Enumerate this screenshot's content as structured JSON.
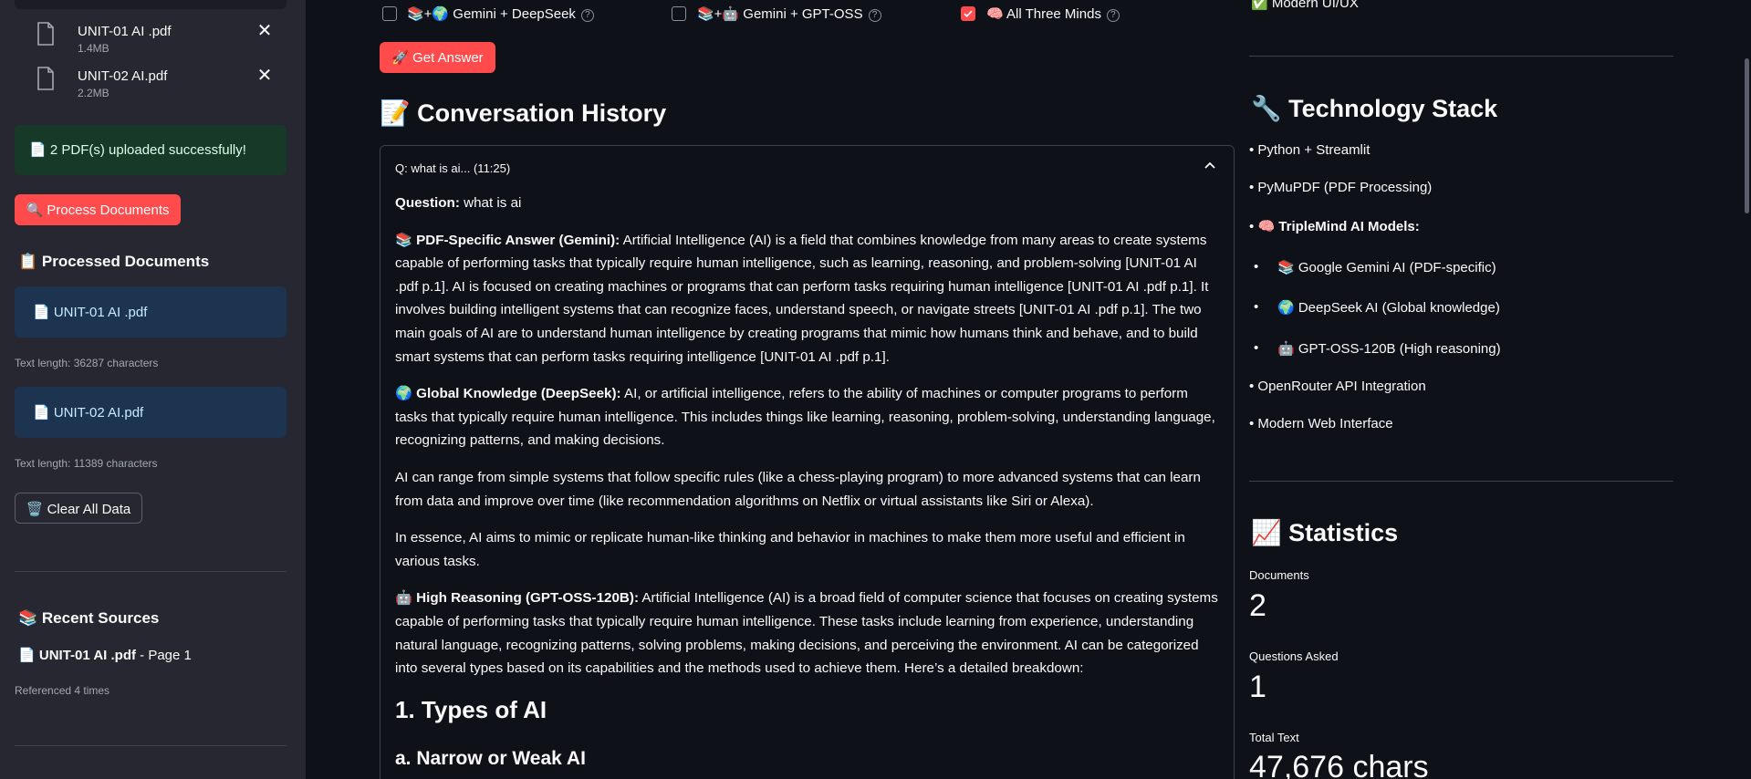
{
  "sidebar": {
    "files": [
      {
        "name": "UNIT-01 AI .pdf",
        "size": "1.4MB"
      },
      {
        "name": "UNIT-02 AI.pdf",
        "size": "2.2MB"
      }
    ],
    "upload_success": "📄 2 PDF(s) uploaded successfully!",
    "process_button": "🔍 Process Documents",
    "processed_heading": "📋 Processed Documents",
    "processed_docs": [
      {
        "name": "📄 UNIT-01 AI .pdf",
        "meta": "Text length: 36287 characters"
      },
      {
        "name": "📄 UNIT-02 AI.pdf",
        "meta": "Text length: 11389 characters"
      }
    ],
    "clear_button": "🗑️ Clear All Data",
    "recent_heading": "📚 Recent Sources",
    "recent_source_name": "UNIT-01 AI .pdf",
    "recent_source_page": " - Page 1",
    "recent_source_meta": "Referenced 4 times"
  },
  "options": [
    {
      "label": "📚+🌍 Gemini + DeepSeek",
      "checked": false
    },
    {
      "label": "📚+🤖 Gemini + GPT-OSS",
      "checked": false
    },
    {
      "label": "🧠 All Three Minds",
      "checked": true
    }
  ],
  "get_answer_button": "🚀 Get Answer",
  "conversation": {
    "title": "📝 Conversation History",
    "expander_label": "Q: what is ai... (11:25)",
    "question_label": "Question:",
    "question": " what is ai",
    "pdf_label": "📚 PDF-Specific Answer (Gemini):",
    "pdf_answer": " Artificial Intelligence (AI) is a field that combines knowledge from many areas to create systems capable of performing tasks that typically require human intelligence, such as learning, reasoning, and problem-solving [UNIT-01 AI .pdf p.1]. AI is focused on creating machines or programs that can perform tasks requiring human intelligence [UNIT-01 AI .pdf p.1]. It involves building intelligent systems that can recognize faces, understand speech, or navigate streets [UNIT-01 AI .pdf p.1]. The two main goals of AI are to understand human intelligence by creating programs that mimic how humans think and behave, and to build smart systems that can perform tasks requiring intelligence [UNIT-01 AI .pdf p.1].",
    "global_label": "🌍 Global Knowledge (DeepSeek):",
    "global_answer": " AI, or artificial intelligence, refers to the ability of machines or computer programs to perform tasks that typically require human intelligence. This includes things like learning, reasoning, problem-solving, understanding language, recognizing patterns, and making decisions.",
    "global_para2": "AI can range from simple systems that follow specific rules (like a chess-playing program) to more advanced systems that can learn from data and improve over time (like recommendation algorithms on Netflix or virtual assistants like Siri or Alexa).",
    "global_para3": "In essence, AI aims to mimic or replicate human-like thinking and behavior in machines to make them more useful and efficient in various tasks.",
    "reason_label": "🤖 High Reasoning (GPT-OSS-120B):",
    "reason_answer": " Artificial Intelligence (AI) is a broad field of computer science that focuses on creating systems capable of performing tasks that typically require human intelligence. These tasks include learning from experience, understanding natural language, recognizing patterns, solving problems, making decisions, and perceiving the environment. AI can be categorized into several types based on its capabilities and the methods used to achieve them. Here’s a detailed breakdown:",
    "heading_types": "1. Types of AI",
    "heading_narrow": "a. Narrow or Weak AI"
  },
  "right": {
    "top_item": "✅ Modern UI/UX",
    "tech_title": "🔧 Technology Stack",
    "tech_items": [
      "• Python + Streamlit",
      "• PyMuPDF (PDF Processing)"
    ],
    "models_label": "🧠 TripleMind AI Models:",
    "models_bullet": "•",
    "models": [
      {
        "bullet": "•",
        "text": "📚 Google Gemini AI (PDF-specific)"
      },
      {
        "bullet": "•",
        "text": "🌍 DeepSeek AI (Global knowledge)"
      },
      {
        "bullet": "•",
        "text": "🤖 GPT-OSS-120B (High reasoning)"
      }
    ],
    "tech_items_2": [
      "• OpenRouter API Integration",
      "• Modern Web Interface"
    ],
    "stats_title": "📈 Statistics",
    "metrics": [
      {
        "label": "Documents",
        "value": "2"
      },
      {
        "label": "Questions Asked",
        "value": "1"
      },
      {
        "label": "Total Text",
        "value": "47,676 chars"
      }
    ]
  }
}
